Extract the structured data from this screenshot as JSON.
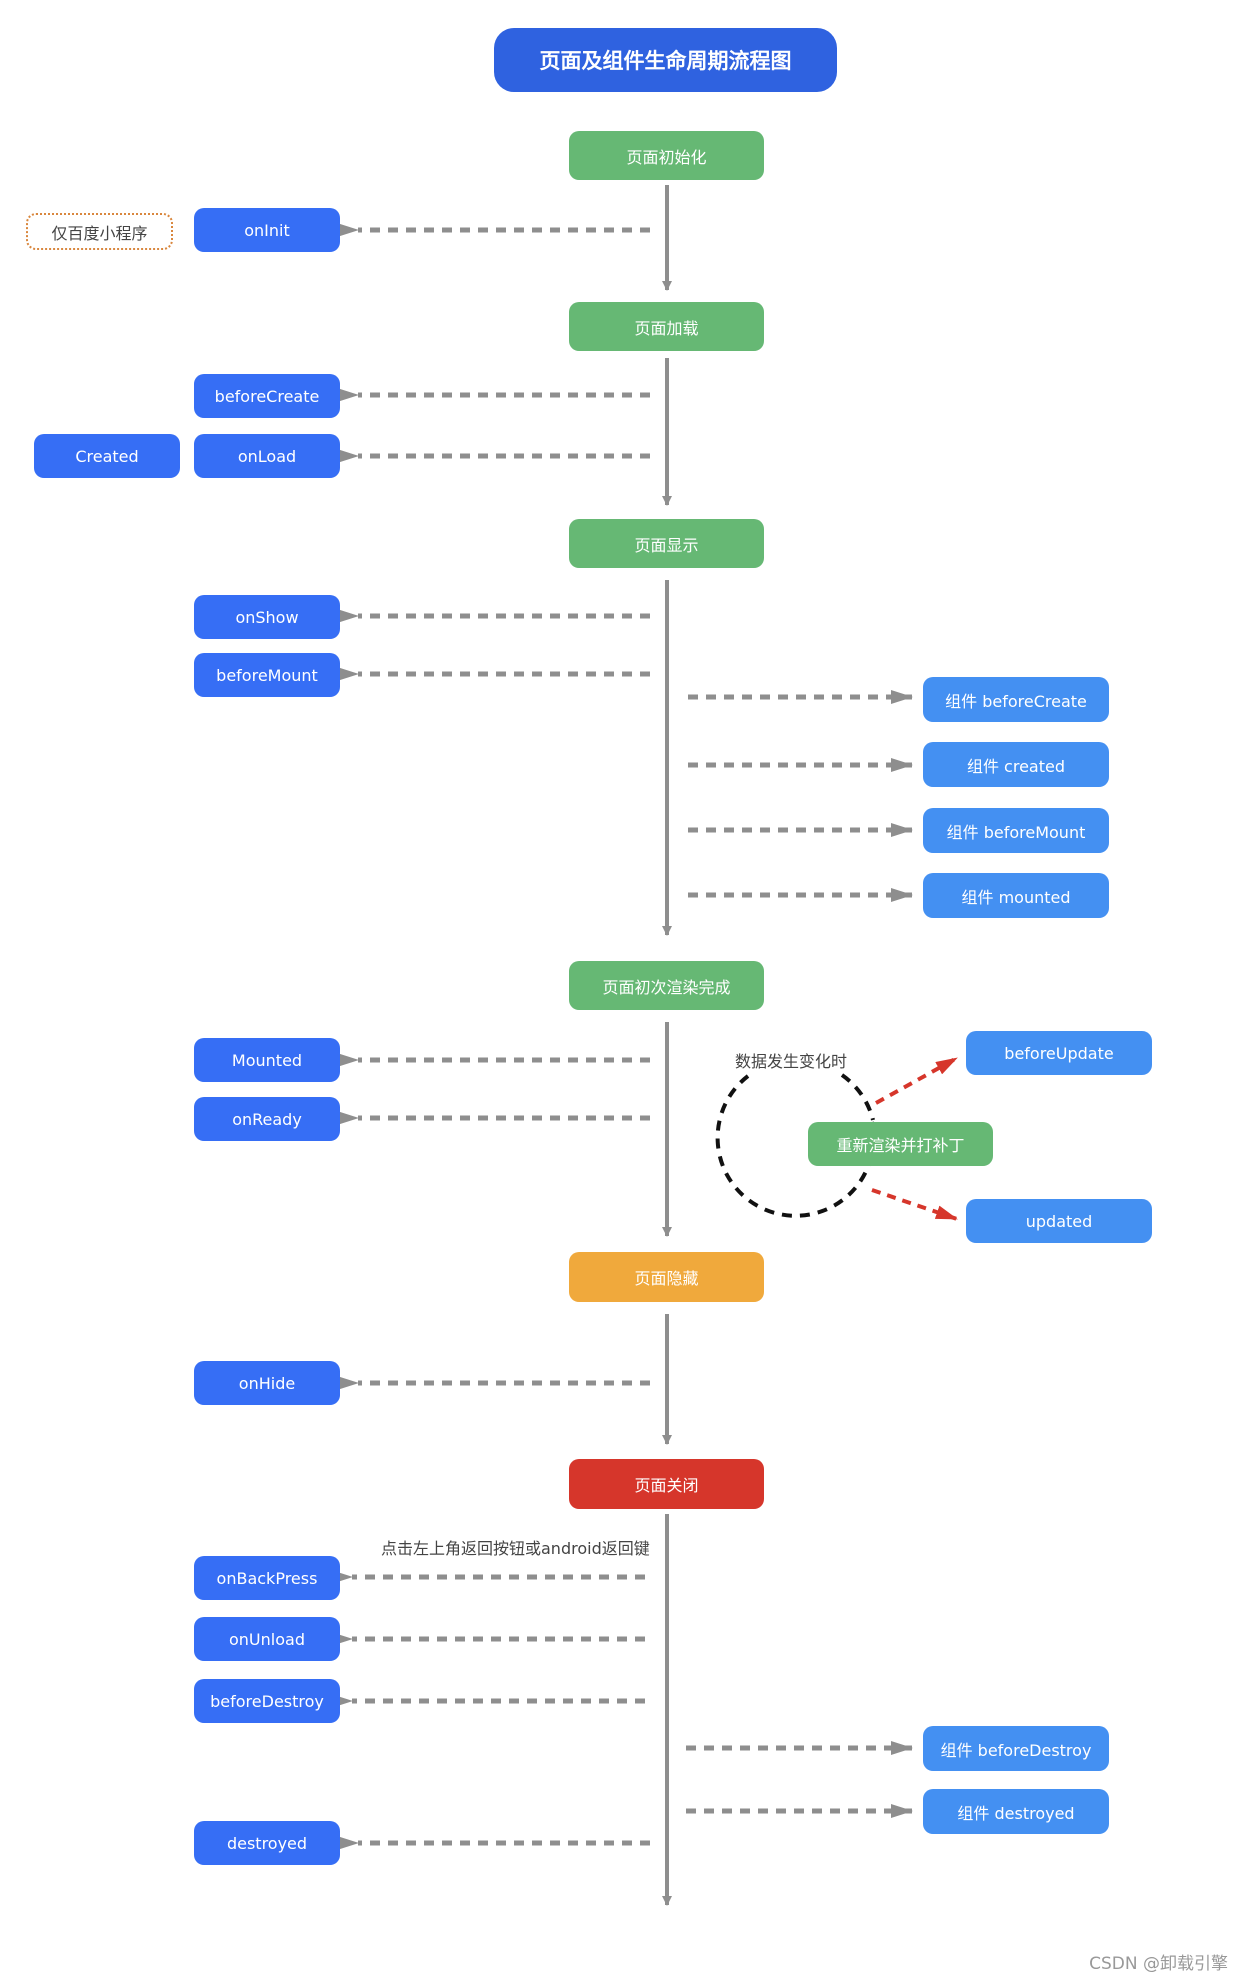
{
  "title": "页面及组件生命周期流程图",
  "stages": {
    "init": "页面初始化",
    "load": "页面加载",
    "show": "页面显示",
    "first_render": "页面初次渲染完成",
    "hide": "页面隐藏",
    "close": "页面关闭"
  },
  "hooks": {
    "onInit": "onInit",
    "baidu_only": "仅百度小程序",
    "beforeCreate": "beforeCreate",
    "created": "Created",
    "onLoad": "onLoad",
    "onShow": "onShow",
    "beforeMount": "beforeMount",
    "mounted": "Mounted",
    "onReady": "onReady",
    "onHide": "onHide",
    "onBackPress": "onBackPress",
    "onUnload": "onUnload",
    "beforeDestroy": "beforeDestroy",
    "destroyed": "destroyed"
  },
  "component_hooks": {
    "beforeCreate": "组件 beforeCreate",
    "created": "组件 created",
    "beforeMount": "组件 beforeMount",
    "mounted": "组件 mounted",
    "beforeDestroy": "组件 beforeDestroy",
    "destroyed": "组件 destroyed"
  },
  "update_cycle": {
    "trigger_label": "数据发生变化时",
    "rerender": "重新渲染并打补丁",
    "beforeUpdate": "beforeUpdate",
    "updated": "updated"
  },
  "back_note": "点击左上角返回按钮或android返回键",
  "watermark": "CSDN @卸载引擎",
  "colors": {
    "title": "#2f62e0",
    "stage": "#66b874",
    "hook": "#366ef5",
    "component_hook": "#4490f2",
    "hide": "#f0a93c",
    "close": "#d6362b",
    "update_arrow": "#d6362b"
  }
}
